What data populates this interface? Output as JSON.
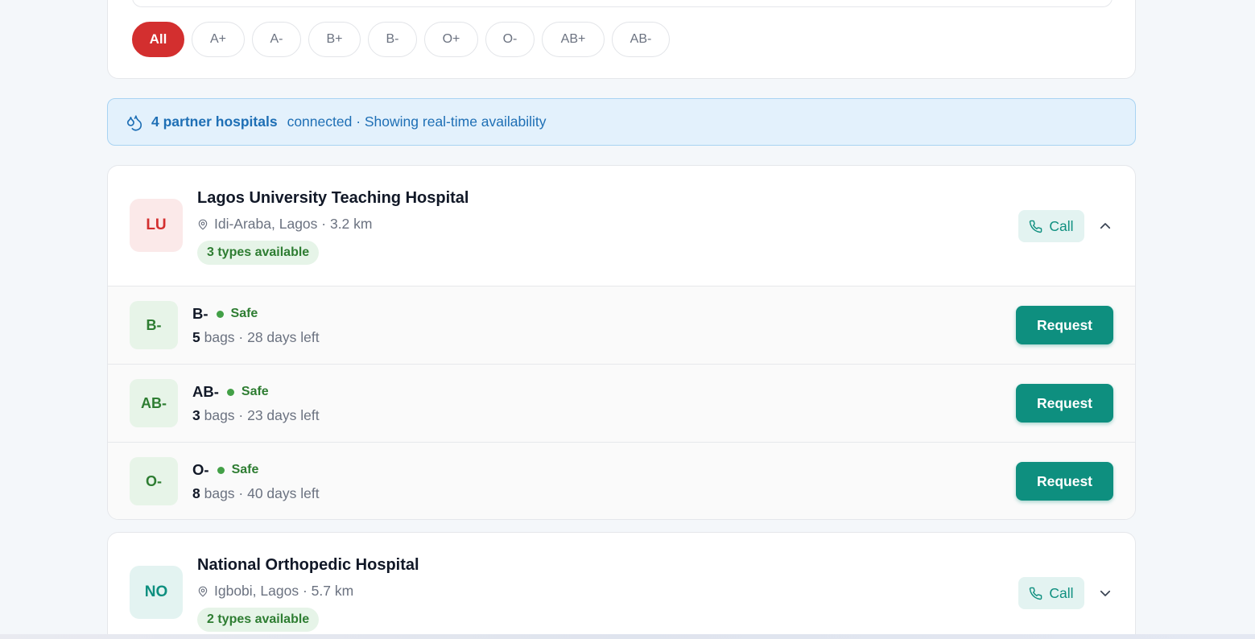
{
  "filters": {
    "chips": [
      {
        "label": "All",
        "active": true
      },
      {
        "label": "A+",
        "active": false
      },
      {
        "label": "A-",
        "active": false
      },
      {
        "label": "B+",
        "active": false
      },
      {
        "label": "B-",
        "active": false
      },
      {
        "label": "O+",
        "active": false
      },
      {
        "label": "O-",
        "active": false
      },
      {
        "label": "AB+",
        "active": false
      },
      {
        "label": "AB-",
        "active": false
      }
    ]
  },
  "banner": {
    "icon": "blood-drops-icon",
    "count_text": "4 partner hospitals",
    "rest_text": "connected · Showing real-time availability"
  },
  "hospitals": [
    {
      "initials": "LU",
      "name": "Lagos University Teaching Hospital",
      "location": "Idi-Araba, Lagos · 3.2 km",
      "types_badge": "3 types available",
      "call_label": "Call",
      "expanded": true,
      "stock": [
        {
          "type": "B-",
          "status": "Safe",
          "bags": "5",
          "detail": "bags · 28 days left",
          "action": "Request"
        },
        {
          "type": "AB-",
          "status": "Safe",
          "bags": "3",
          "detail": "bags · 23 days left",
          "action": "Request"
        },
        {
          "type": "O-",
          "status": "Safe",
          "bags": "8",
          "detail": "bags · 40 days left",
          "action": "Request"
        }
      ]
    },
    {
      "initials": "NO",
      "name": "National Orthopedic Hospital",
      "location": "Igbobi, Lagos · 5.7 km",
      "types_badge": "2 types available",
      "call_label": "Call",
      "expanded": false
    }
  ],
  "colors": {
    "primary_red": "#d32f2f",
    "teal": "#0e8f7f",
    "safe_green": "#2e7d32",
    "info_blue": "#1e6fb5"
  }
}
